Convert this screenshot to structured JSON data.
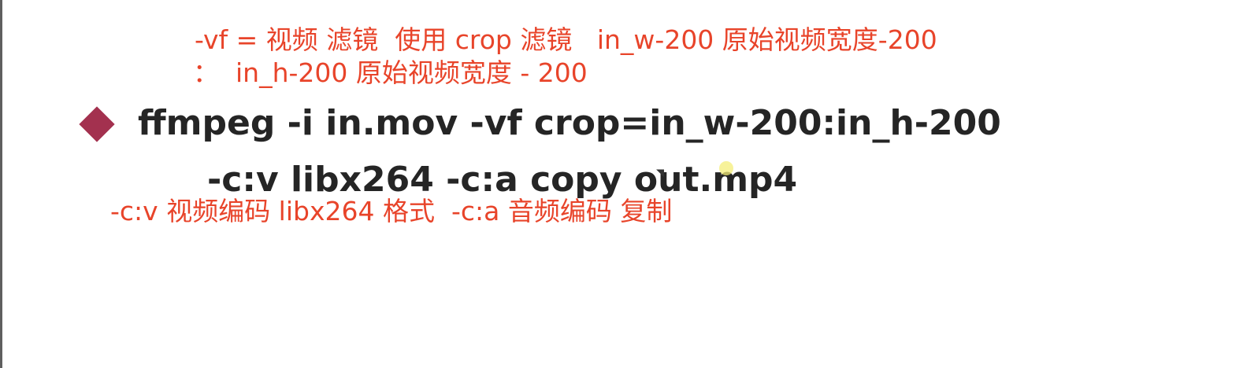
{
  "annotations": {
    "line1": "-vf = 视频 滤镜  使用 crop 滤镜   in_w-200 原始视频宽度-200",
    "line2": "：  in_h-200 原始视频宽度 - 200",
    "line3": "-c:v 视频编码 libx264 格式  -c:a 音频编码 复制"
  },
  "command": {
    "line1": "ffmpeg -i in.mov -vf crop=in_w-200:in_h-200",
    "line2": "-c:v libx264 -c:a copy out.mp4"
  },
  "colors": {
    "annotation": "#e8442a",
    "bullet": "#a3314f",
    "command_text": "#252525",
    "background": "#ffffff"
  },
  "icons": {
    "bullet": "diamond-bullet-icon",
    "cursor": "mouse-pointer-icon",
    "cursor_highlight": "cursor-highlight-icon"
  }
}
